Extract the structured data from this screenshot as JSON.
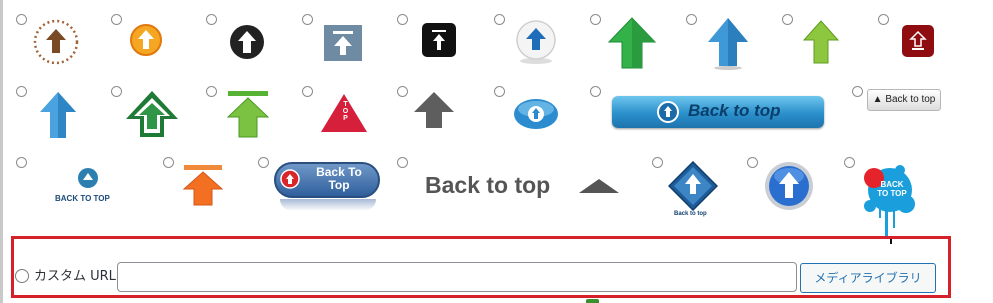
{
  "icon_options": [
    {
      "row": 1,
      "icon": "brown-dotted-circle-up-arrow-icon"
    },
    {
      "row": 1,
      "icon": "orange-circle-up-arrow-icon"
    },
    {
      "row": 1,
      "icon": "black-circle-up-arrow-icon"
    },
    {
      "row": 1,
      "icon": "gray-square-top-arrow-icon"
    },
    {
      "row": 1,
      "icon": "black-square-top-arrow-icon"
    },
    {
      "row": 1,
      "icon": "white-orb-blue-up-arrow-icon"
    },
    {
      "row": 1,
      "icon": "green-up-arrow-icon"
    },
    {
      "row": 1,
      "icon": "blue-up-arrow-icon"
    },
    {
      "row": 1,
      "icon": "lime-up-arrow-icon"
    },
    {
      "row": 1,
      "icon": "dark-red-square-up-arrow-icon"
    },
    {
      "row": 2,
      "icon": "blue-3d-up-arrow-icon"
    },
    {
      "row": 2,
      "icon": "green-outline-tree-arrow-icon"
    },
    {
      "row": 2,
      "icon": "green-bar-up-arrow-icon"
    },
    {
      "row": 2,
      "icon": "red-triangle-top-icon"
    },
    {
      "row": 2,
      "icon": "gray-up-arrow-icon"
    },
    {
      "row": 2,
      "icon": "blue-oval-up-arrow-icon"
    },
    {
      "row": 2,
      "icon": "blue-bar-back-to-top-icon"
    },
    {
      "row": 2,
      "icon": "small-back-to-top-button-icon"
    },
    {
      "row": 3,
      "icon": "blue-circle-back-to-top-icon"
    },
    {
      "row": 3,
      "icon": "orange-bar-up-arrow-icon"
    },
    {
      "row": 3,
      "icon": "blue-pill-back-to-top-icon"
    },
    {
      "row": 3,
      "icon": "back-to-top-text-triangle-icon"
    },
    {
      "row": 3,
      "icon": "blue-diamond-back-to-top-icon"
    },
    {
      "row": 3,
      "icon": "blue-glossy-circle-up-arrow-icon"
    },
    {
      "row": 3,
      "icon": "splash-back-to-top-icon"
    }
  ],
  "labels": {
    "small_button": "▲ Back to top",
    "blue_bar": "Back to top",
    "circle_label": "BACK TO TOP",
    "pill_line1": "Back To",
    "pill_line2": "Top",
    "big_text": "Back to top",
    "diamond_label": "Back to top",
    "splash_line1": "BACK",
    "splash_line2": "TO TOP",
    "triangle_label": "TOP"
  },
  "custom": {
    "label": "カスタム URL",
    "url_value": "",
    "media_button_label": "メディアライブラリ"
  },
  "colors": {
    "highlight_border": "#d6202a",
    "link_blue": "#2271b1"
  }
}
